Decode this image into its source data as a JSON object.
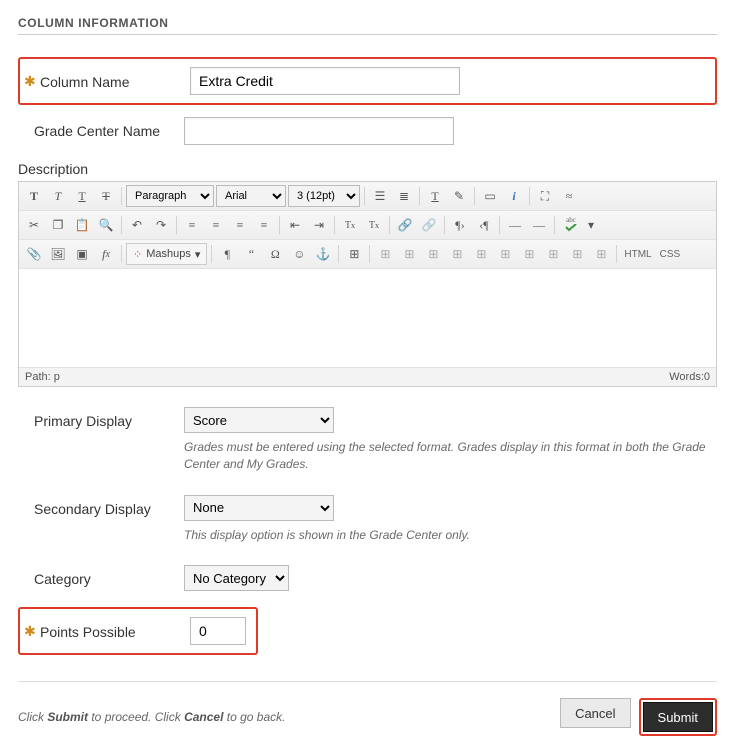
{
  "section_title": "COLUMN INFORMATION",
  "fields": {
    "column_name": {
      "label": "Column Name",
      "value": "Extra Credit"
    },
    "grade_center_name": {
      "label": "Grade Center Name",
      "value": ""
    },
    "description": {
      "label": "Description"
    },
    "primary_display": {
      "label": "Primary Display",
      "value": "Score",
      "help": "Grades must be entered using the selected format. Grades display in this format in both the Grade Center and My Grades."
    },
    "secondary_display": {
      "label": "Secondary Display",
      "value": "None",
      "help": "This display option is shown in the Grade Center only."
    },
    "category": {
      "label": "Category",
      "value": "No Category"
    },
    "points_possible": {
      "label": "Points Possible",
      "value": "0"
    }
  },
  "editor": {
    "format": "Paragraph",
    "font": "Arial",
    "size": "3 (12pt)",
    "mashups": "Mashups",
    "html": "HTML",
    "css": "CSS",
    "path_label": "Path: p",
    "words_label": "Words:0"
  },
  "footer": {
    "text_pre": "Click ",
    "submit_bold": "Submit",
    "text_mid": " to proceed. Click ",
    "cancel_bold": "Cancel",
    "text_post": " to go back.",
    "cancel": "Cancel",
    "submit": "Submit"
  }
}
